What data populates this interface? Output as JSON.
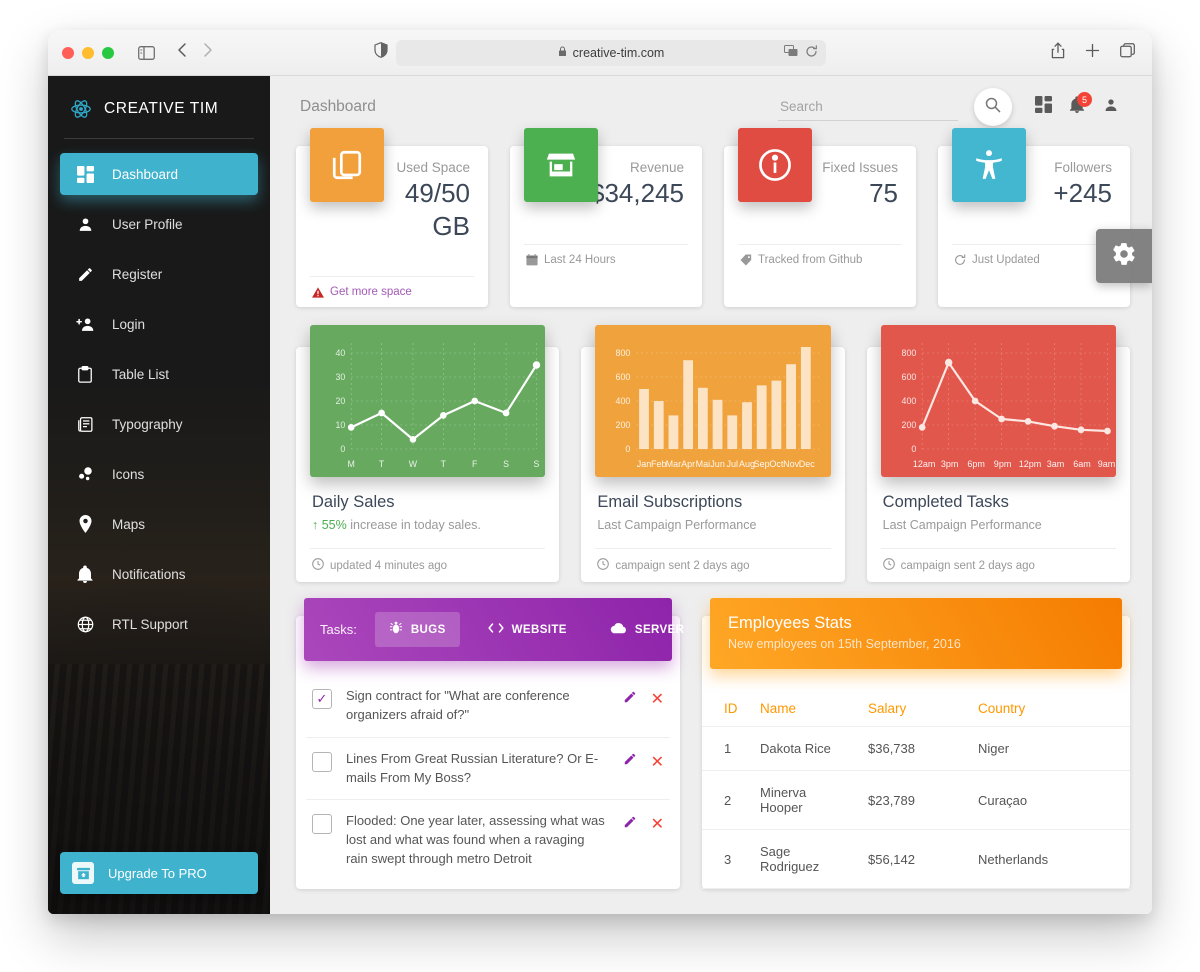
{
  "browser": {
    "url": "creative-tim.com",
    "lock_icon": "lock-icon",
    "traffic_lights": [
      "close",
      "minimize",
      "zoom"
    ],
    "toolbar_icons": [
      "sidebar-icon",
      "back-icon",
      "forward-icon",
      "shield-icon",
      "translate-icon",
      "reload-icon",
      "share-icon",
      "new-tab-icon",
      "tab-overview-icon"
    ]
  },
  "sidebar": {
    "brand": "CREATIVE TIM",
    "brand_logo": "atom-icon",
    "items": [
      {
        "label": "Dashboard",
        "icon": "dashboard-icon",
        "active": true
      },
      {
        "label": "User Profile",
        "icon": "person-icon",
        "active": false
      },
      {
        "label": "Register",
        "icon": "pencil-icon",
        "active": false
      },
      {
        "label": "Login",
        "icon": "person-add-icon",
        "active": false
      },
      {
        "label": "Table List",
        "icon": "clipboard-icon",
        "active": false
      },
      {
        "label": "Typography",
        "icon": "article-icon",
        "active": false
      },
      {
        "label": "Icons",
        "icon": "bubble-chart-icon",
        "active": false
      },
      {
        "label": "Maps",
        "icon": "location-pin-icon",
        "active": false
      },
      {
        "label": "Notifications",
        "icon": "bell-icon",
        "active": false
      },
      {
        "label": "RTL Support",
        "icon": "globe-icon",
        "active": false
      }
    ],
    "upgrade": {
      "label": "Upgrade To PRO",
      "icon": "unarchive-icon"
    }
  },
  "topnav": {
    "page_title": "Dashboard",
    "search": {
      "placeholder": "Search",
      "value": ""
    },
    "search_icon": "search-icon",
    "dashboard_icon": "grid-icon",
    "notifications_icon": "bell-icon",
    "notifications_count": "5",
    "person_icon": "person-icon",
    "settings_icon": "gear-icon"
  },
  "stat_cards": [
    {
      "label": "Used Space",
      "value": "49/50",
      "value2": "GB",
      "icon": "content-copy-icon",
      "color": "#f2a03c",
      "footer": "Get more space",
      "footer_icon": "warning-icon",
      "footer_link": true
    },
    {
      "label": "Revenue",
      "value": "$34,245",
      "value2": "",
      "icon": "store-icon",
      "color": "#4caf50",
      "footer": "Last 24 Hours",
      "footer_icon": "calendar-icon",
      "footer_link": false
    },
    {
      "label": "Fixed Issues",
      "value": "75",
      "value2": "",
      "icon": "info-icon",
      "color": "#e04b42",
      "footer": "Tracked from Github",
      "footer_icon": "tag-icon",
      "footer_link": false
    },
    {
      "label": "Followers",
      "value": "+245",
      "value2": "",
      "icon": "accessibility-icon",
      "color": "#43b6d0",
      "footer": "Just Updated",
      "footer_icon": "refresh-icon",
      "footer_link": false
    }
  ],
  "chart_cards": [
    {
      "title": "Daily Sales",
      "subtitle_prefix": "55%",
      "subtitle": "increase in today sales.",
      "subtitle_icon": "arrow-up-icon",
      "footer": "updated 4 minutes ago",
      "footer_icon": "clock-icon",
      "color": "#66a95f"
    },
    {
      "title": "Email Subscriptions",
      "subtitle_prefix": "",
      "subtitle": "Last Campaign Performance",
      "subtitle_icon": "",
      "footer": "campaign sent 2 days ago",
      "footer_icon": "clock-icon",
      "color": "#f0a23c"
    },
    {
      "title": "Completed Tasks",
      "subtitle_prefix": "",
      "subtitle": "Last Campaign Performance",
      "subtitle_icon": "",
      "footer": "campaign sent 2 days ago",
      "footer_icon": "clock-icon",
      "color": "#e2574c"
    }
  ],
  "chart_data": [
    {
      "type": "line",
      "title": "Daily Sales",
      "categories": [
        "M",
        "T",
        "W",
        "T",
        "F",
        "S",
        "S"
      ],
      "values": [
        9,
        15,
        4,
        14,
        20,
        15,
        35
      ],
      "yticks": [
        0,
        10,
        20,
        30,
        40
      ],
      "ylim": [
        0,
        45
      ],
      "xlabel": "",
      "ylabel": "",
      "grid": true,
      "legend": "none",
      "bg_color": "#66a95f",
      "series_color": "#ffffff"
    },
    {
      "type": "bar",
      "title": "Email Subscriptions",
      "categories": [
        "Jan",
        "Feb",
        "Mar",
        "Apr",
        "Mai",
        "Jun",
        "Jul",
        "Aug",
        "Sep",
        "Oct",
        "Nov",
        "Dec"
      ],
      "values": [
        500,
        400,
        280,
        740,
        510,
        410,
        280,
        390,
        530,
        570,
        710,
        850
      ],
      "yticks": [
        0,
        200,
        400,
        600,
        800
      ],
      "ylim": [
        0,
        900
      ],
      "xlabel": "",
      "ylabel": "",
      "grid": true,
      "legend": "none",
      "bg_color": "#f0a23c",
      "series_color": "#fbe3c4"
    },
    {
      "type": "line",
      "title": "Completed Tasks",
      "categories": [
        "12am",
        "3pm",
        "6pm",
        "9pm",
        "12pm",
        "3am",
        "6am",
        "9am"
      ],
      "values": [
        180,
        720,
        400,
        250,
        230,
        190,
        160,
        150
      ],
      "yticks": [
        0,
        200,
        400,
        600,
        800
      ],
      "ylim": [
        0,
        900
      ],
      "xlabel": "",
      "ylabel": "",
      "grid": true,
      "legend": "none",
      "bg_color": "#e2574c",
      "series_color": "#ffffff"
    }
  ],
  "tasks_card": {
    "label": "Tasks:",
    "tabs": [
      {
        "label": "BUGS",
        "icon": "bug-icon",
        "active": true
      },
      {
        "label": "WEBSITE",
        "icon": "code-icon",
        "active": false
      },
      {
        "label": "SERVER",
        "icon": "cloud-icon",
        "active": false
      }
    ],
    "rows": [
      {
        "checked": true,
        "text": "Sign contract for \"What are conference organizers afraid of?\""
      },
      {
        "checked": false,
        "text": "Lines From Great Russian Literature? Or E-mails From My Boss?"
      },
      {
        "checked": false,
        "text": "Flooded: One year later, assessing what was lost and what was found when a ravaging rain swept through metro Detroit"
      }
    ],
    "edit_icon": "pencil-icon",
    "delete_icon": "close-icon"
  },
  "employees_card": {
    "title": "Employees Stats",
    "subtitle": "New employees on 15th September, 2016",
    "columns": [
      "ID",
      "Name",
      "Salary",
      "Country"
    ],
    "rows": [
      [
        "1",
        "Dakota Rice",
        "$36,738",
        "Niger"
      ],
      [
        "2",
        "Minerva Hooper",
        "$23,789",
        "Curaçao"
      ],
      [
        "3",
        "Sage Rodriguez",
        "$56,142",
        "Netherlands"
      ]
    ]
  },
  "colors": {
    "accent": "#3fb2cd",
    "orange": "#f2a03c",
    "green": "#4caf50",
    "red": "#e04b42",
    "purple": "#8e24aa",
    "sidebar": "#1f1f1f",
    "page_bg": "#eeeeee"
  }
}
